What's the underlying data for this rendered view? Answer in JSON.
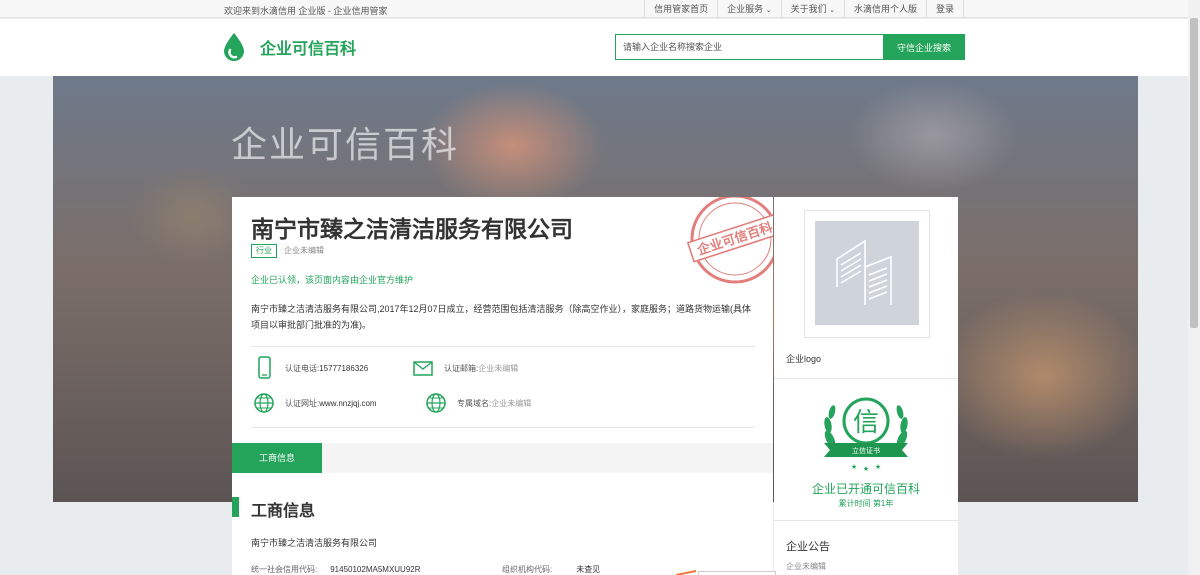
{
  "topbar": {
    "welcome": "欢迎来到水滴信用 企业版 - 企业信用管家",
    "nav": [
      {
        "label": "信用管家首页",
        "caret": ""
      },
      {
        "label": "企业服务",
        "caret": "⌄"
      },
      {
        "label": "关于我们",
        "caret": "⌄"
      },
      {
        "label": "水滴信用个人版",
        "caret": ""
      },
      {
        "label": "登录",
        "caret": ""
      }
    ]
  },
  "header": {
    "brand": "企业可信百科",
    "brand_icon": "water-drop-icon",
    "search_placeholder": "请输入企业名称搜索企业",
    "search_button": "守信企业搜索",
    "accent": "#23a45a"
  },
  "hero": {
    "title": "企业可信百科"
  },
  "company": {
    "name": "南宁市臻之洁清洁服务有限公司",
    "tag": "行业",
    "tag_value": "企业未编辑",
    "certified": "企业已认领，该页面内容由企业官方维护",
    "description": "南宁市臻之洁清洁服务有限公司,2017年12月07日成立，经营范围包括清洁服务（除高空作业），家庭服务；道路货物运输(具体项目以审批部门批准的为准)。",
    "stamp_text": "企业可信百科",
    "phone_label": "认证电话: ",
    "phone_value": "15777186326",
    "email_label": "认证邮箱: ",
    "email_value": "企业未编辑",
    "site_label": "认证网址: ",
    "site_value": "www.nnzjqj.com",
    "domain_label": "专属域名: ",
    "domain_value": "企业未编辑"
  },
  "tabs": [
    {
      "label": "工商信息",
      "active": true
    }
  ],
  "business": {
    "title": "工商信息",
    "company": "南宁市臻之洁清洁服务有限公司",
    "credit_code_label": "统一社会信用代码:",
    "credit_code_value": "91450102MA5MXUU92R",
    "org_code_label": "组织机构代码:",
    "org_code_value": "未查见"
  },
  "sidebar": {
    "logo_label": "企业logo",
    "badge_text": "立信证书",
    "badge_char": "信",
    "open_text": "企业已开通可信百科",
    "open_sub": "累计时间 第1年",
    "notice_title": "企业公告",
    "notice_value": "企业未编辑"
  }
}
